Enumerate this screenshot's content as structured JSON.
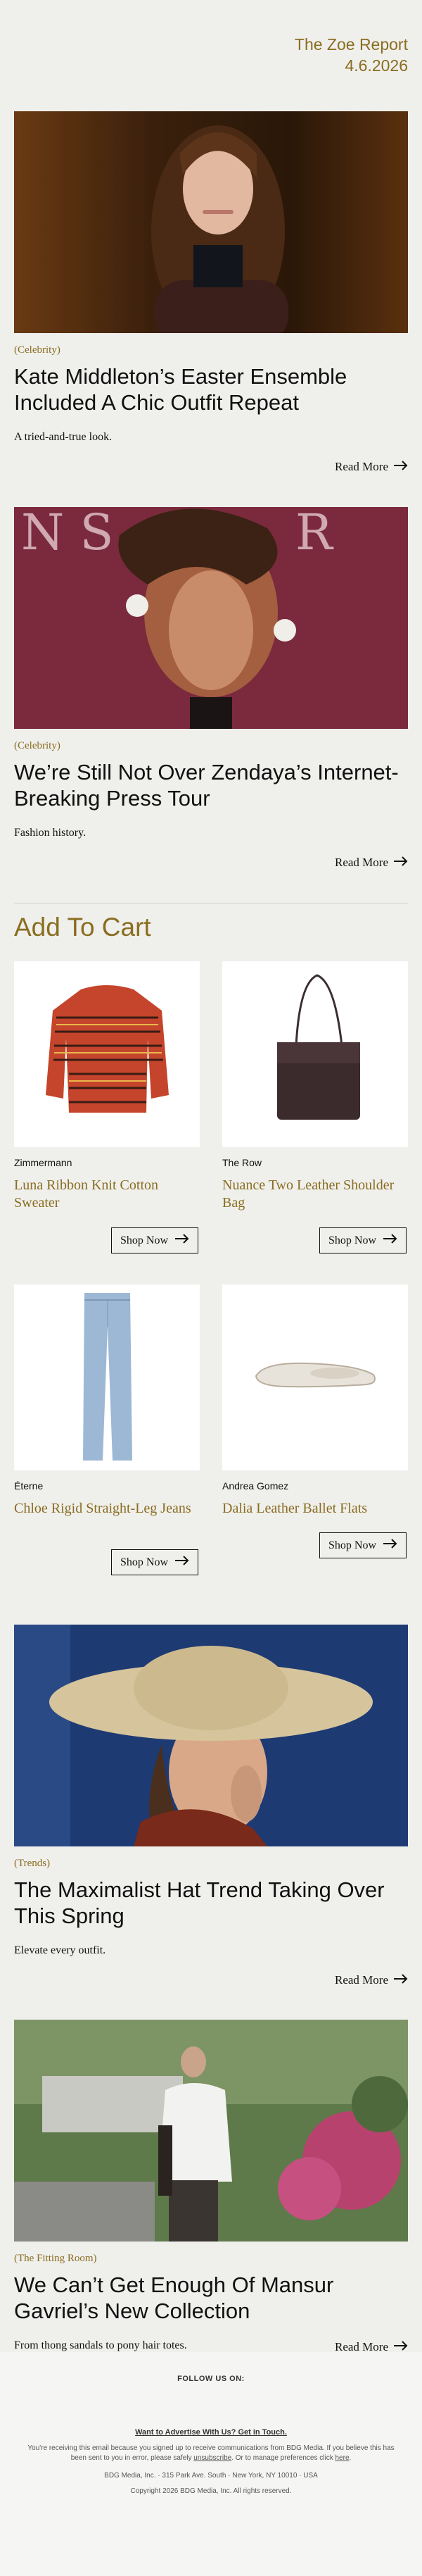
{
  "header": {
    "brand": "The Zoe Report",
    "date": "4.6.2026"
  },
  "articles": [
    {
      "category": "(Celebrity)",
      "title": "Kate Middleton’s Easter Ensemble Included A Chic Outfit Repeat",
      "dek": "A tried-and-true look.",
      "read_more": "Read More"
    },
    {
      "category": "(Celebrity)",
      "title": "We’re Still Not Over Zendaya’s Internet-Breaking Press Tour",
      "dek": "Fashion history.",
      "read_more": "Read More"
    },
    {
      "category": "(Trends)",
      "title": "The Maximalist Hat Trend Taking Over This Spring",
      "dek": "Elevate every outfit.",
      "read_more": "Read More"
    },
    {
      "category": "(The Fitting Room)",
      "title": "We Can’t Get Enough Of Mansur Gavriel’s New Collection",
      "dek": "From thong sandals to pony hair totes.",
      "read_more": "Read More"
    }
  ],
  "shop": {
    "title": "Add To Cart",
    "products": [
      {
        "brand": "Zimmermann",
        "name": "Luna Ribbon Knit Cotton Sweater",
        "cta": "Shop Now"
      },
      {
        "brand": "The Row",
        "name": "Nuance Two Leather Shoulder Bag",
        "cta": "Shop Now"
      },
      {
        "brand": "Éterne",
        "name": "Chloe Rigid Straight-Leg Jeans",
        "cta": "Shop Now"
      },
      {
        "brand": "Andrea Gomez",
        "name": "Dalia Leather Ballet Flats",
        "cta": "Shop Now"
      }
    ]
  },
  "footer": {
    "follow": "FOLLOW US ON:",
    "advertise": "Want to Advertise With Us? Get in Touch.",
    "legal_pre": "You're receiving this email because you signed up to receive communications from BDG Media. If you believe this has been sent to you in error, please safely ",
    "unsubscribe": "unsubscribe",
    "legal_mid": ". Or to manage preferences click ",
    "here": "here",
    "legal_end": ".",
    "address": "BDG Media, Inc. · 315 Park Ave. South · New York, NY 10010 · USA",
    "copyright": "Copyright 2026 BDG Media, Inc. All rights reserved."
  },
  "colors": {
    "accent": "#8a6d1f",
    "background": "#efefec"
  }
}
